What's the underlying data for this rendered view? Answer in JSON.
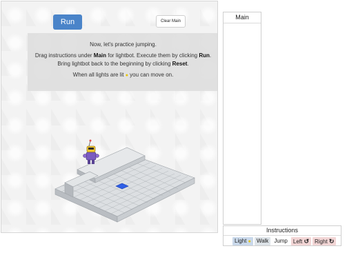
{
  "toolbar": {
    "run_label": "Run",
    "clear_label": "Clear Main"
  },
  "info": {
    "line1": "Now, let's practice jumping.",
    "line2a": "Drag instructions under ",
    "line2b": "Main",
    "line2c": " for lightbot. Execute them by clicking ",
    "line2d": "Run",
    "line2e": ". Bring lightbot back to the beginning by clicking ",
    "line2f": "Reset",
    "line2g": ".",
    "line3a": "When all lights are lit",
    "line3b": " you can move on."
  },
  "main_panel": {
    "title": "Main"
  },
  "instructions_panel": {
    "title": "Instructions",
    "items": [
      {
        "label": "Light",
        "icon": "bulb-icon"
      },
      {
        "label": "Walk"
      },
      {
        "label": "Jump"
      },
      {
        "label": "Left",
        "icon": "rotate-left-icon"
      },
      {
        "label": "Right",
        "icon": "rotate-right-icon"
      }
    ]
  },
  "colors": {
    "run_button": "#4a84c9",
    "goal_tile": "#2f5fe6",
    "board_tile": "#d9dcdf",
    "bulb": "#e7c400",
    "turn_instruction": "#f2d5d5",
    "light_instruction": "#c9d8ea"
  }
}
